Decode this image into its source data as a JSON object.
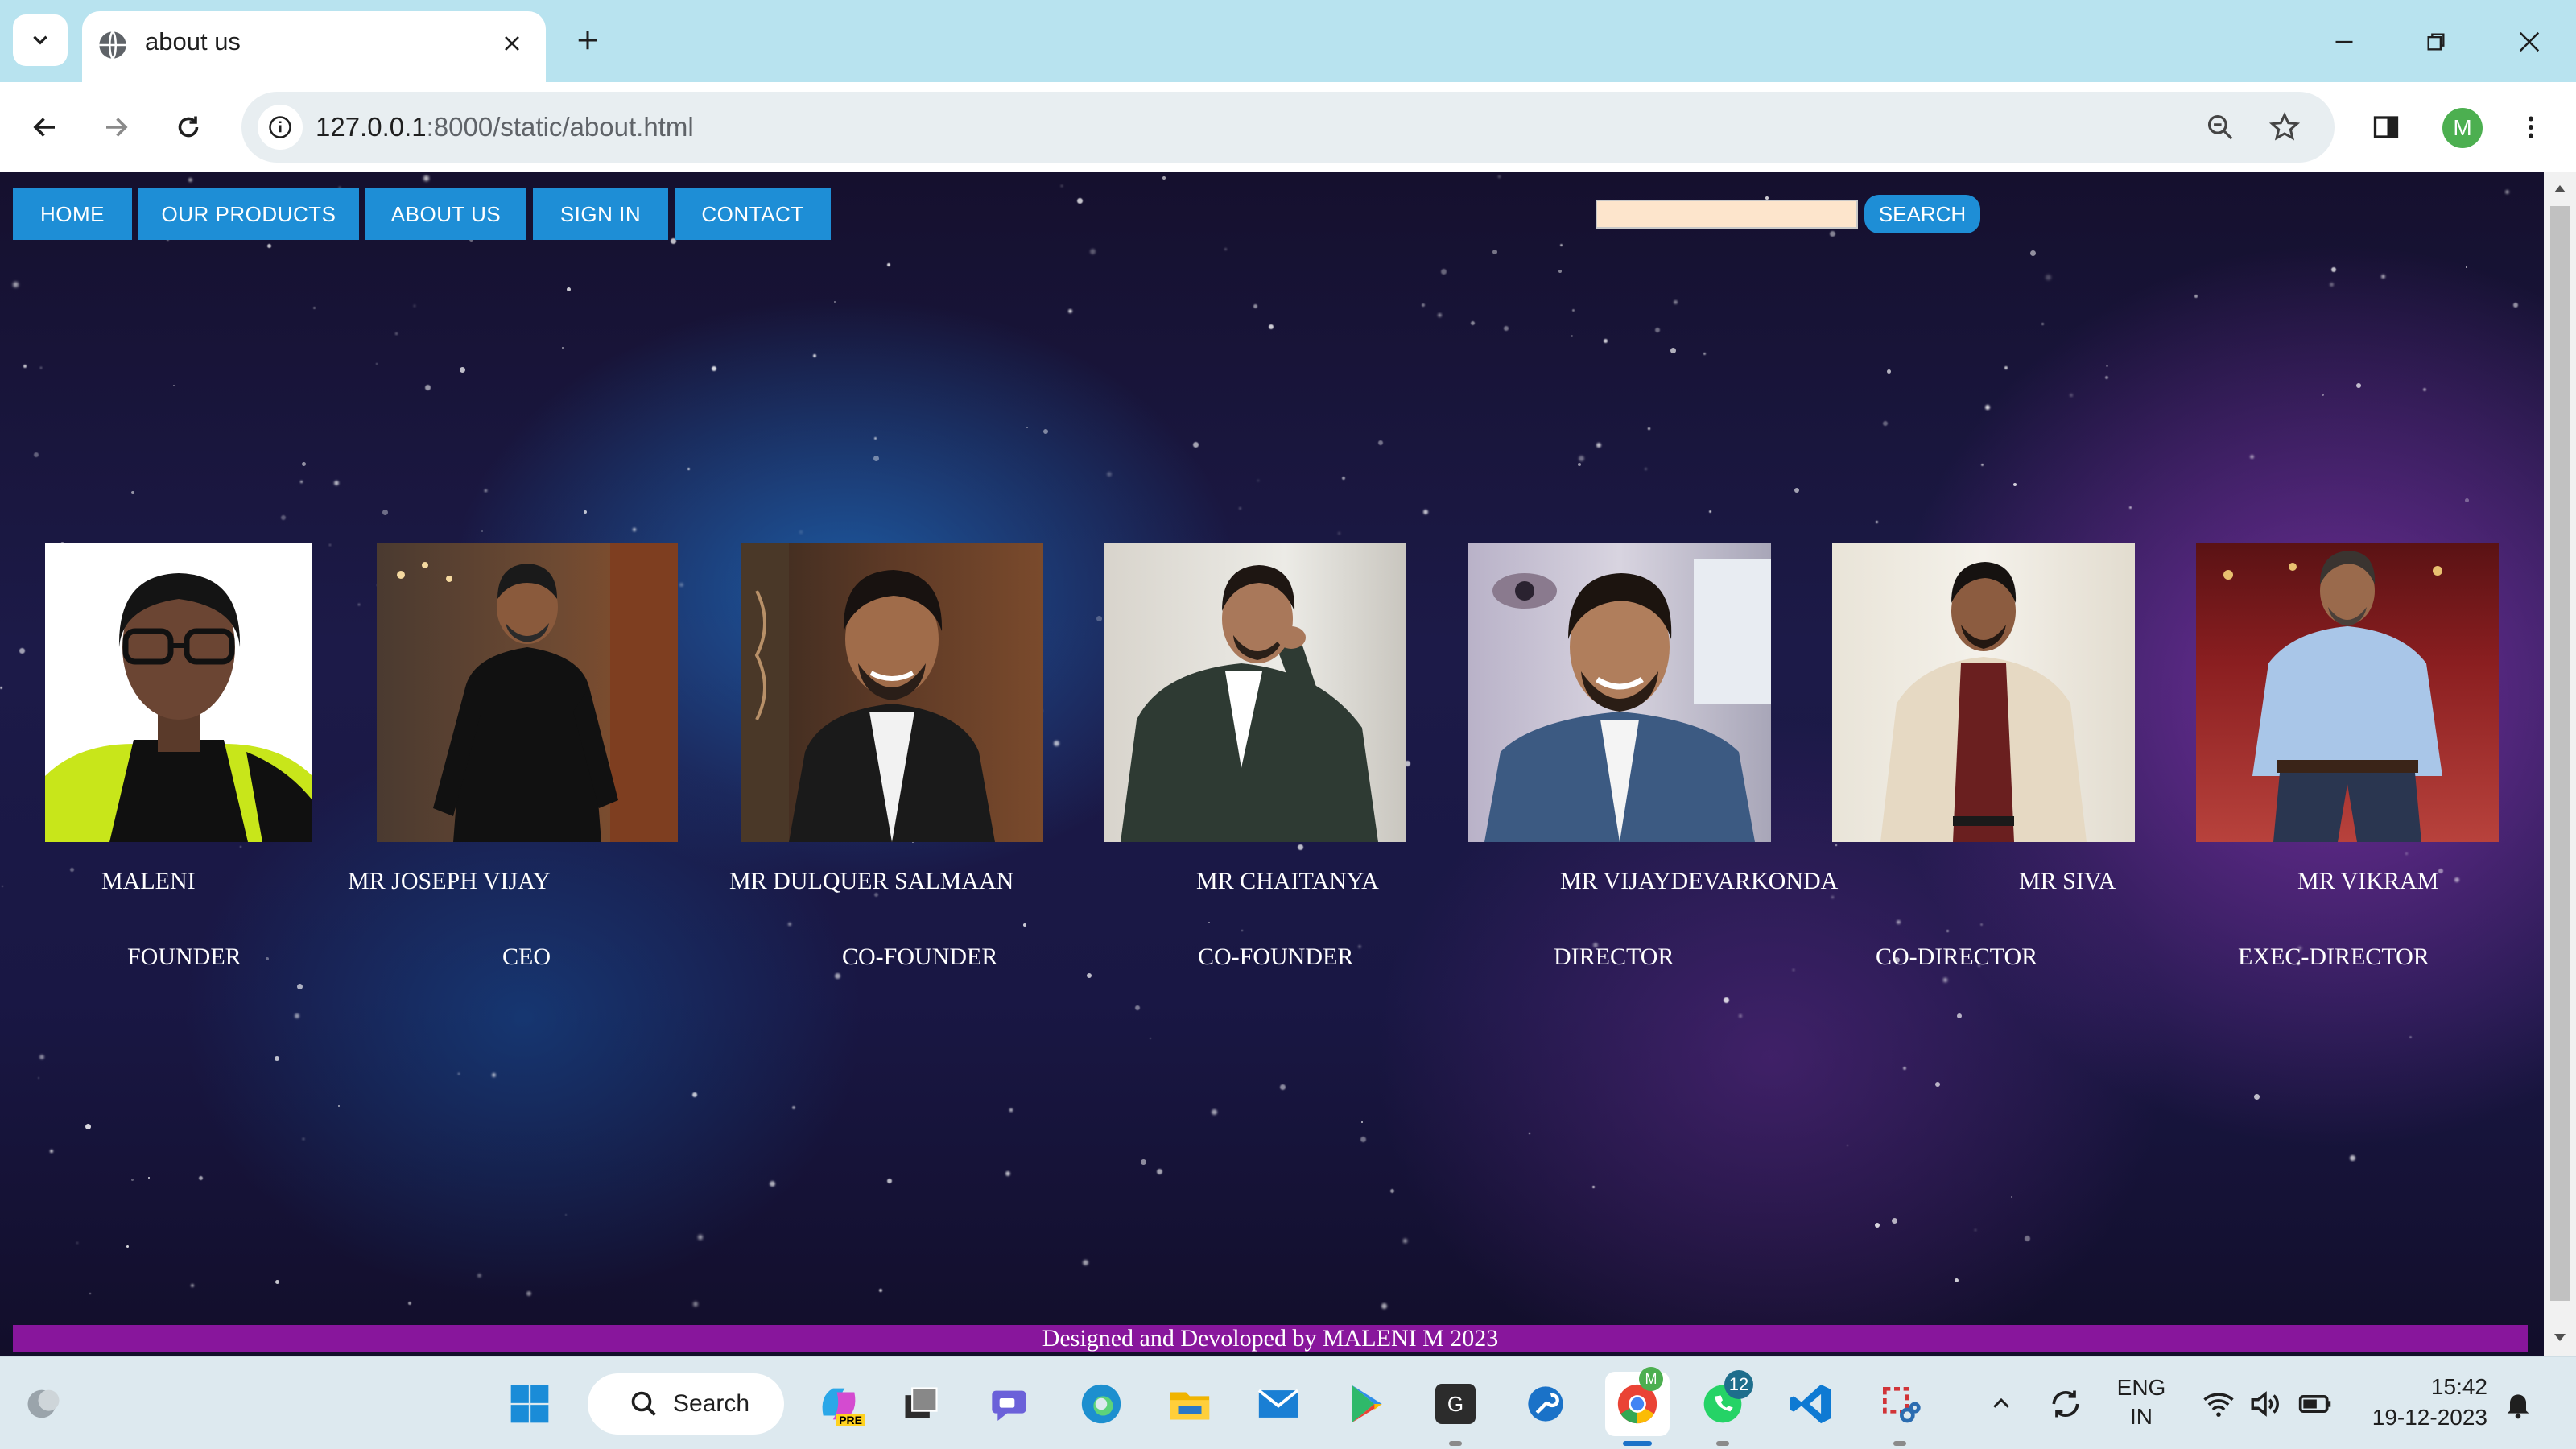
{
  "browser": {
    "tab_title": "about us",
    "url_host": "127.0.0.1",
    "url_rest": ":8000/static/about.html",
    "profile_initial": "M",
    "icons": [
      "tab-list-icon",
      "globe-icon",
      "close-icon",
      "plus-icon",
      "minimize-icon",
      "restore-icon",
      "back-icon",
      "forward-icon",
      "reload-icon",
      "info-icon",
      "zoom-icon",
      "star-icon",
      "sidepanel-icon",
      "menu-icon"
    ]
  },
  "page": {
    "nav": [
      {
        "label": "HOME"
      },
      {
        "label": "OUR PRODUCTS"
      },
      {
        "label": "ABOUT US"
      },
      {
        "label": "SIGN IN"
      },
      {
        "label": "CONTACT"
      }
    ],
    "search_value": "",
    "search_button": "SEARCH",
    "team": [
      {
        "name": "MALENI",
        "role": "FOUNDER"
      },
      {
        "name": "MR JOSEPH VIJAY",
        "role": "CEO"
      },
      {
        "name": "MR DULQUER SALMAAN",
        "role": "CO-FOUNDER"
      },
      {
        "name": "MR CHAITANYA",
        "role": "CO-FOUNDER"
      },
      {
        "name": "MR VIJAYDEVARKONDA",
        "role": "DIRECTOR"
      },
      {
        "name": "MR SIVA",
        "role": "CO-DIRECTOR"
      },
      {
        "name": "MR VIKRAM",
        "role": "EXEC-DIRECTOR"
      }
    ],
    "footer": "Designed and Devoloped by MALENI M 2023",
    "colors": {
      "nav_bg": "#1e8ed6",
      "footer_bg": "#88169c",
      "search_bg": "#fde5cc"
    }
  },
  "taskbar": {
    "search_label": "Search",
    "whatsapp_badge": "12",
    "chrome_profile_badge": "M",
    "lang_line1": "ENG",
    "lang_line2": "IN",
    "time": "15:42",
    "date": "19-12-2023",
    "copilot_label": "PRE",
    "g_label": "G"
  }
}
